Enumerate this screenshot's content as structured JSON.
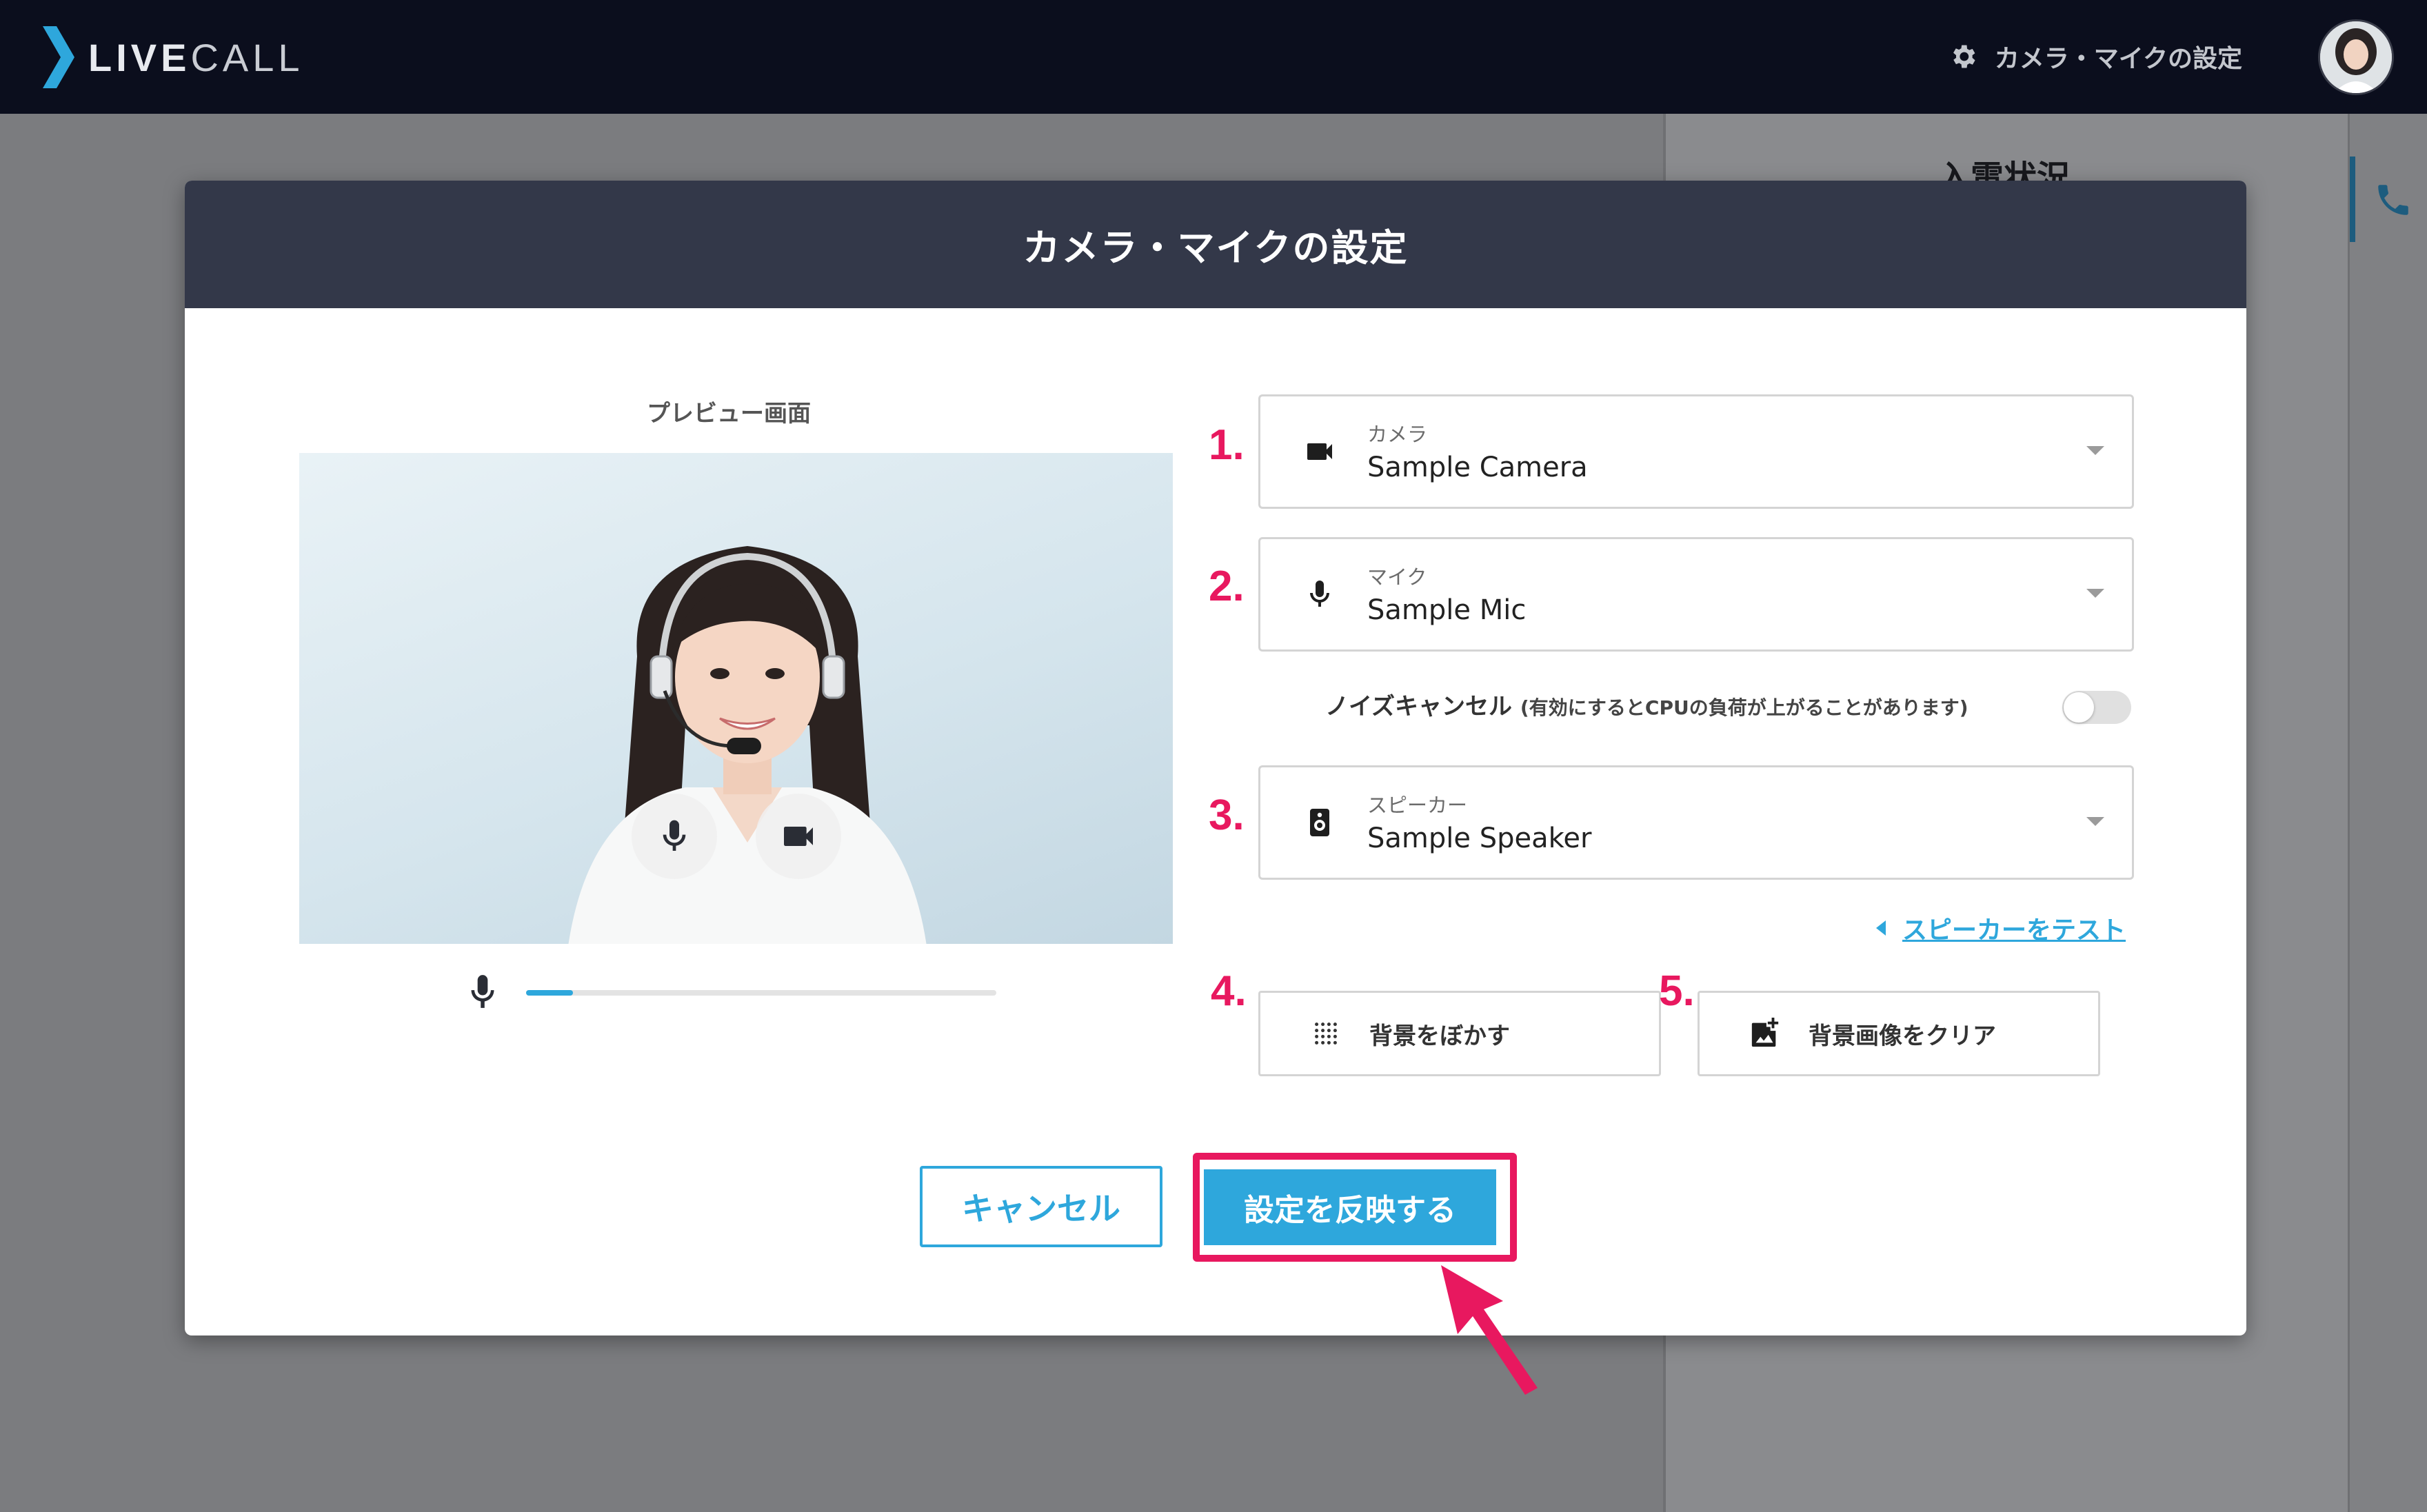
{
  "app": {
    "logo_light": "LIVE",
    "logo_dark": "CALL"
  },
  "header": {
    "settings_label": "カメラ・マイクの設定"
  },
  "background": {
    "panel_title": "入電状況"
  },
  "modal": {
    "title": "カメラ・マイクの設定",
    "preview_label": "プレビュー画面",
    "mic_level": 0.1,
    "camera": {
      "number": "1.",
      "label": "カメラ",
      "value": "Sample Camera"
    },
    "mic": {
      "number": "2.",
      "label": "マイク",
      "value": "Sample Mic"
    },
    "noise_cancel": {
      "label": "ノイズキャンセル",
      "note": "(有効にするとCPUの負荷が上がることがあります)",
      "enabled": false
    },
    "speaker": {
      "number": "3.",
      "label": "スピーカー",
      "value": "Sample Speaker"
    },
    "speaker_test_label": "スピーカーをテスト",
    "blur": {
      "number": "4.",
      "label": "背景をぼかす"
    },
    "clear_bg": {
      "number": "5.",
      "label": "背景画像をクリア"
    },
    "cancel_label": "キャンセル",
    "apply_label": "設定を反映する"
  },
  "colors": {
    "accent": "#2ea7dc",
    "annotation": "#e8185f",
    "header_bg": "#0b0e1d",
    "modal_head_bg": "#333849"
  }
}
